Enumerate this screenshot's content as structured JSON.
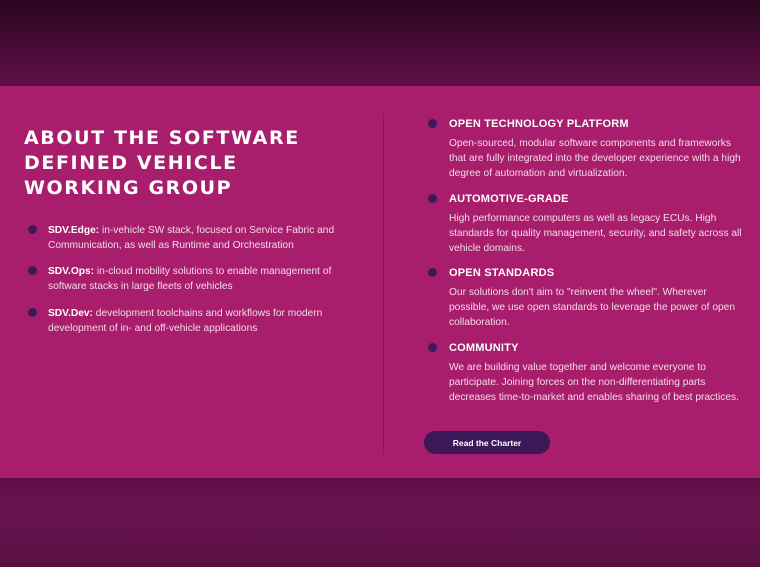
{
  "section": {
    "title": "ABOUT THE SOFTWARE DEFINED VEHICLE WORKING GROUP"
  },
  "left_items": [
    {
      "term": "SDV.Edge:",
      "text": " in-vehicle SW stack, focused on Service Fabric and Communication, as well as Runtime and Orchestration"
    },
    {
      "term": "SDV.Ops:",
      "text": " in-cloud mobility solutions to enable management of software stacks in large fleets of vehicles"
    },
    {
      "term": "SDV.Dev:",
      "text": " development toolchains and workflows for modern development of in- and off-vehicle applications"
    }
  ],
  "right_items": [
    {
      "heading": "OPEN TECHNOLOGY PLATFORM",
      "text": "Open-sourced, modular software components and frameworks that are fully integrated into the developer experience with a high degree of automation and virtualization."
    },
    {
      "heading": "AUTOMOTIVE-GRADE",
      "text": "High performance computers as well as legacy ECUs. High standards for quality management, security, and safety across all vehicle domains."
    },
    {
      "heading": "OPEN STANDARDS",
      "text": "Our solutions don't aim to \"reinvent the wheel\". Wherever possible, we use open standards to leverage the power of open collaboration."
    },
    {
      "heading": "COMMUNITY",
      "text": "We are building value together and welcome everyone to participate. Joining forces on the non-differentiating parts decreases time-to-market and enables sharing of best practices."
    }
  ],
  "cta": {
    "label": "Read the Charter"
  },
  "colors": {
    "panel": "#a81e6c",
    "bullet": "#3a1a5a",
    "button": "#3b1858",
    "outer": "#5c0f45"
  },
  "icons": {
    "bullet": "dot-icon"
  }
}
